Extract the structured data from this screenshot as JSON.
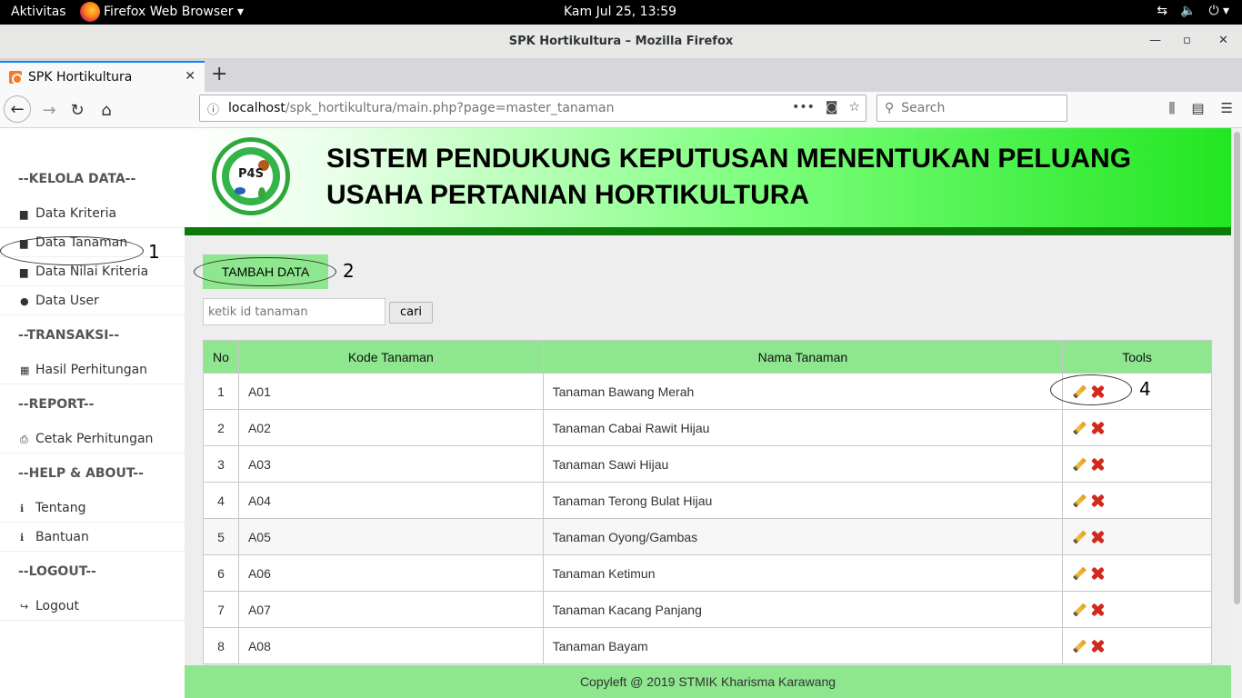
{
  "system": {
    "activities": "Aktivitas",
    "app_menu": "Firefox Web Browser ▾",
    "clock": "Kam Jul 25, 13:59"
  },
  "window": {
    "title": "SPK Hortikultura – Mozilla Firefox"
  },
  "browser": {
    "tab_title": "SPK Hortikultura",
    "url_host": "localhost",
    "url_path": "/spk_hortikultura/main.php?page=master_tanaman",
    "search_placeholder": "Search"
  },
  "sidebar": {
    "sections": [
      {
        "heading": "--KELOLA DATA--",
        "items": [
          {
            "label": "Data Kriteria",
            "icon": "archive-icon"
          },
          {
            "label": "Data Tanaman",
            "icon": "archive-icon"
          },
          {
            "label": "Data Nilai Kriteria",
            "icon": "archive-icon"
          },
          {
            "label": "Data User",
            "icon": "user-icon"
          }
        ]
      },
      {
        "heading": "--TRANSAKSI--",
        "items": [
          {
            "label": "Hasil Perhitungan",
            "icon": "table-icon"
          }
        ]
      },
      {
        "heading": "--REPORT--",
        "items": [
          {
            "label": "Cetak Perhitungan",
            "icon": "print-icon"
          }
        ]
      },
      {
        "heading": "--HELP & ABOUT--",
        "items": [
          {
            "label": "Tentang",
            "icon": "info-icon"
          },
          {
            "label": "Bantuan",
            "icon": "info-icon"
          }
        ]
      },
      {
        "heading": "--LOGOUT--",
        "items": [
          {
            "label": "Logout",
            "icon": "logout-icon"
          }
        ]
      }
    ]
  },
  "banner": {
    "logo_text": "P4S",
    "headline_line1": "SISTEM PENDUKUNG KEPUTUSAN MENENTUKAN PELUANG",
    "headline_line2": "USAHA PERTANIAN HORTIKULTURA"
  },
  "toolbar": {
    "add_label": "TAMBAH DATA",
    "search_placeholder": "ketik id tanaman",
    "search_button": "cari"
  },
  "annotations": {
    "one": "1",
    "two": "2",
    "four": "4"
  },
  "table": {
    "headers": [
      "No",
      "Kode Tanaman",
      "Nama Tanaman",
      "Tools"
    ],
    "rows": [
      [
        "1",
        "A01",
        "Tanaman Bawang Merah"
      ],
      [
        "2",
        "A02",
        "Tanaman Cabai Rawit Hijau"
      ],
      [
        "3",
        "A03",
        "Tanaman Sawi Hijau"
      ],
      [
        "4",
        "A04",
        "Tanaman Terong Bulat Hijau"
      ],
      [
        "5",
        "A05",
        "Tanaman Oyong/Gambas"
      ],
      [
        "6",
        "A06",
        "Tanaman Ketimun"
      ],
      [
        "7",
        "A07",
        "Tanaman Kacang Panjang"
      ],
      [
        "8",
        "A08",
        "Tanaman Bayam"
      ]
    ]
  },
  "footer": {
    "text": "Copyleft @ 2019 STMIK Kharisma Karawang"
  },
  "colors": {
    "accent_green": "#8ee68e",
    "dark_green": "#0b7a0b",
    "delete_red": "#d2281e"
  }
}
